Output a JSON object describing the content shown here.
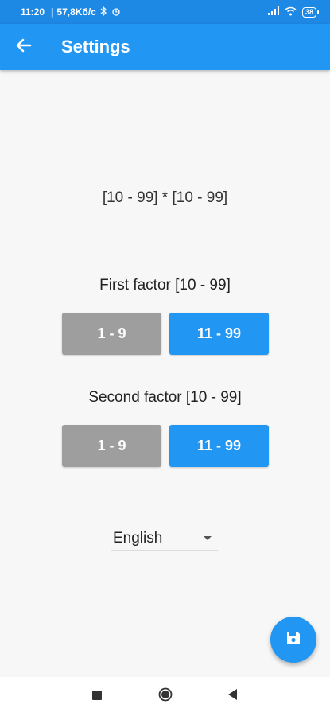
{
  "status_bar": {
    "time": "11:20",
    "network_speed": "57,8Kб/c",
    "battery": "38"
  },
  "app_bar": {
    "title": "Settings",
    "back_icon": "arrow-back-icon"
  },
  "formula": "[10 - 99] * [10 - 99]",
  "first_factor": {
    "label": "First factor [10 - 99]",
    "options": [
      "1 - 9",
      "11 - 99"
    ],
    "selected": "11 - 99"
  },
  "second_factor": {
    "label": "Second factor [10 - 99]",
    "options": [
      "1 - 9",
      "11 - 99"
    ],
    "selected": "11 - 99"
  },
  "language": {
    "selected": "English"
  },
  "fab": {
    "icon": "save-icon"
  },
  "nav_bar": {
    "icons": [
      "square-recents-icon",
      "circle-home-icon",
      "triangle-back-icon"
    ]
  },
  "colors": {
    "primary": "#2196f3",
    "status_bar": "#1e88e5",
    "inactive": "#9e9e9e",
    "background": "#f7f7f7"
  }
}
